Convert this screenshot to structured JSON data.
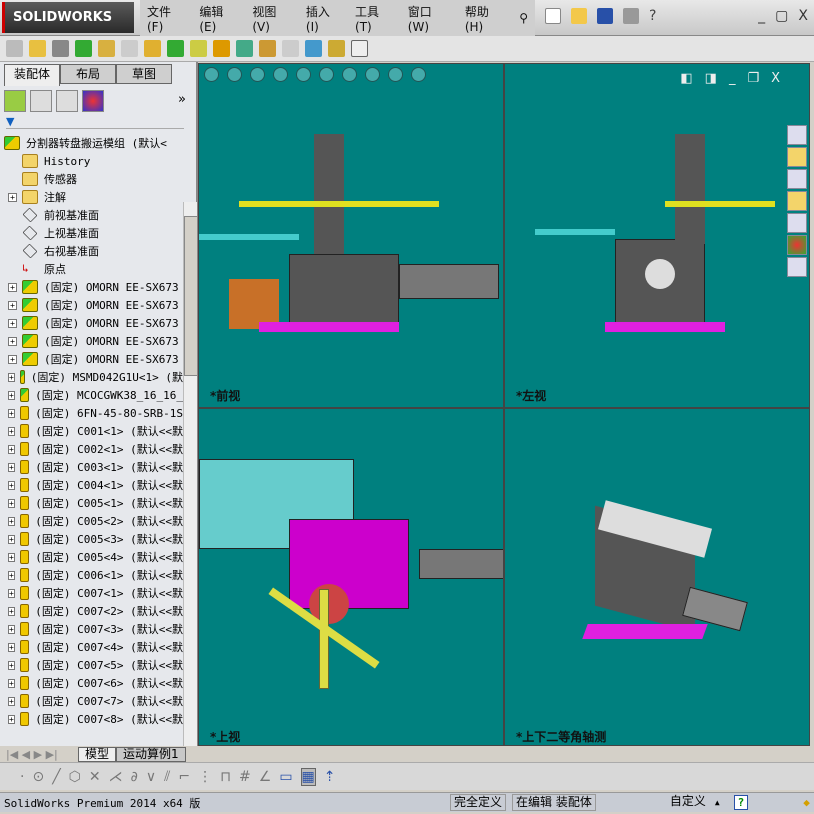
{
  "app": {
    "logo": "SOLIDWORKS",
    "brand_color": "#c00000"
  },
  "menu": [
    "文件(F)",
    "编辑(E)",
    "视图(V)",
    "插入(I)",
    "工具(T)",
    "窗口(W)",
    "帮助(H)"
  ],
  "left_panel": {
    "tabs": [
      "装配体",
      "布局",
      "草图"
    ],
    "active_tab": "装配体",
    "more": "»",
    "filter_icon": "filter-icon",
    "tree": [
      {
        "label": "分割器转盘搬运模组  (默认<",
        "icon": "assembly",
        "expand": false,
        "root": true
      },
      {
        "label": "History",
        "icon": "history-folder",
        "expand": false
      },
      {
        "label": "传感器",
        "icon": "sensor-folder",
        "expand": false
      },
      {
        "label": "注解",
        "icon": "annotation-folder",
        "expand": true
      },
      {
        "label": "前视基准面",
        "icon": "plane",
        "expand": false
      },
      {
        "label": "上视基准面",
        "icon": "plane",
        "expand": false
      },
      {
        "label": "右视基准面",
        "icon": "plane",
        "expand": false
      },
      {
        "label": "原点",
        "icon": "origin",
        "expand": false
      },
      {
        "label": "(固定) OMORN   EE-SX673",
        "icon": "assembly",
        "expand": true
      },
      {
        "label": "(固定) OMORN   EE-SX673",
        "icon": "assembly",
        "expand": true
      },
      {
        "label": "(固定) OMORN   EE-SX673",
        "icon": "assembly",
        "expand": true
      },
      {
        "label": "(固定) OMORN   EE-SX673",
        "icon": "assembly",
        "expand": true
      },
      {
        "label": "(固定) OMORN   EE-SX673",
        "icon": "assembly",
        "expand": true
      },
      {
        "label": "(固定) MSMD042G1U<1> (默",
        "icon": "assembly",
        "expand": true
      },
      {
        "label": "(固定) MCOCGWK38_16_16_",
        "icon": "assembly",
        "expand": true
      },
      {
        "label": "(固定) 6FN-45-80-SRB-1S",
        "icon": "part",
        "expand": true
      },
      {
        "label": "(固定) C001<1> (默认<<默",
        "icon": "part",
        "expand": true
      },
      {
        "label": "(固定) C002<1> (默认<<默",
        "icon": "part",
        "expand": true
      },
      {
        "label": "(固定) C003<1> (默认<<默",
        "icon": "part",
        "expand": true
      },
      {
        "label": "(固定) C004<1> (默认<<默",
        "icon": "part",
        "expand": true
      },
      {
        "label": "(固定) C005<1> (默认<<默",
        "icon": "part",
        "expand": true
      },
      {
        "label": "(固定) C005<2> (默认<<默",
        "icon": "part",
        "expand": true
      },
      {
        "label": "(固定) C005<3> (默认<<默",
        "icon": "part",
        "expand": true
      },
      {
        "label": "(固定) C005<4> (默认<<默",
        "icon": "part",
        "expand": true
      },
      {
        "label": "(固定) C006<1> (默认<<默",
        "icon": "part",
        "expand": true
      },
      {
        "label": "(固定) C007<1> (默认<<默",
        "icon": "part",
        "expand": true
      },
      {
        "label": "(固定) C007<2> (默认<<默",
        "icon": "part",
        "expand": true
      },
      {
        "label": "(固定) C007<3> (默认<<默",
        "icon": "part",
        "expand": true
      },
      {
        "label": "(固定) C007<4> (默认<<默",
        "icon": "part",
        "expand": true
      },
      {
        "label": "(固定) C007<5> (默认<<默",
        "icon": "part",
        "expand": true
      },
      {
        "label": "(固定) C007<6> (默认<<默",
        "icon": "part",
        "expand": true
      },
      {
        "label": "(固定) C007<7> (默认<<默",
        "icon": "part",
        "expand": true
      },
      {
        "label": "(固定) C007<8> (默认<<默",
        "icon": "part",
        "expand": true
      }
    ]
  },
  "viewports": {
    "background": "#00807f",
    "panes": [
      {
        "label": "*前视"
      },
      {
        "label": "*左视"
      },
      {
        "label": "*上视"
      },
      {
        "label": "*上下二等角轴测"
      }
    ],
    "controls": [
      "◧",
      "◨",
      "_",
      "❐",
      "X"
    ]
  },
  "bottom_tabs": [
    "模型",
    "运动算例1"
  ],
  "active_bottom_tab": "模型",
  "status": {
    "product": "SolidWorks Premium 2014 x64 版",
    "state": "完全定义",
    "editing": "在编辑 装配体",
    "units": "自定义",
    "units_arrow": "▲",
    "help": "?"
  }
}
